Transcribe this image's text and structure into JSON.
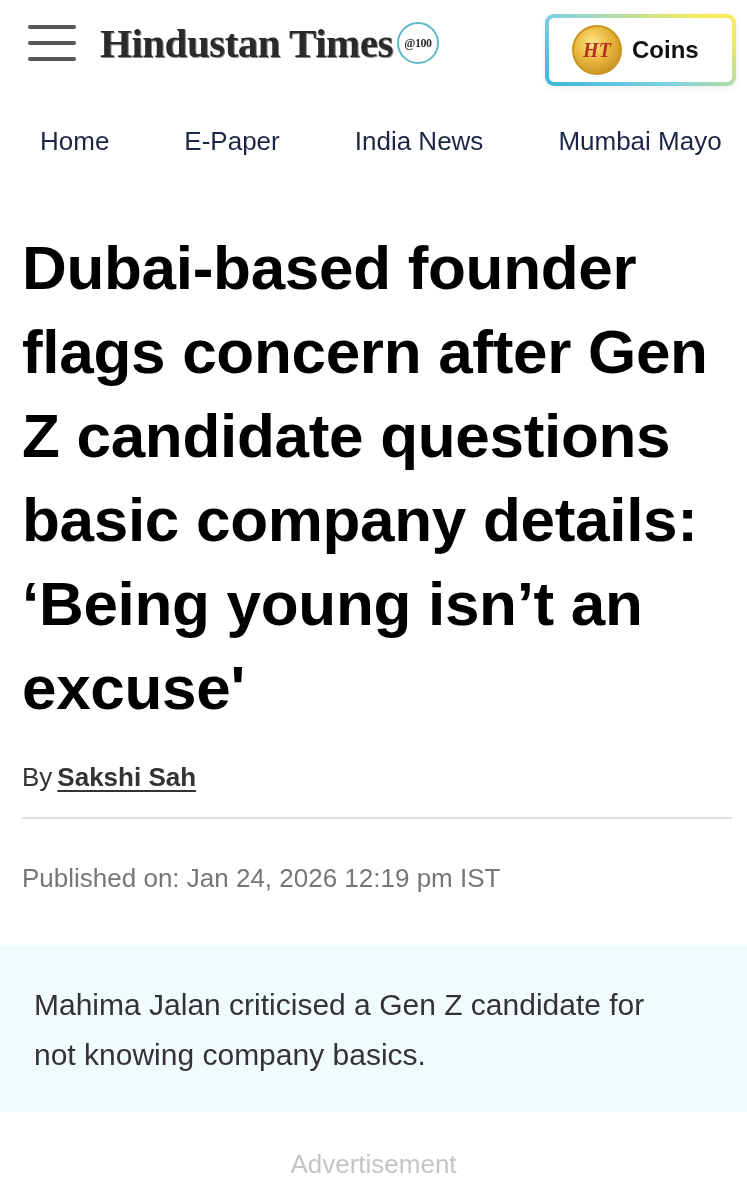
{
  "header": {
    "logo": "Hindustan Times",
    "badge": "@100",
    "coins_button": {
      "coin_mark": "HT",
      "label": "Coins"
    }
  },
  "nav": [
    "Home",
    "E-Paper",
    "India News",
    "Mumbai Mayo"
  ],
  "article": {
    "headline": "Dubai-based founder flags concern after Gen Z candidate questions basic company details: ‘Being young isn’t an excuse'",
    "byline": {
      "prefix": "By",
      "author": "Sakshi Sah"
    },
    "published": "Published on: Jan 24, 2026 12:19 pm IST",
    "summary": "Mahima Jalan criticised a Gen Z candidate for not knowing company basics.",
    "ad_label": "Advertisement"
  }
}
